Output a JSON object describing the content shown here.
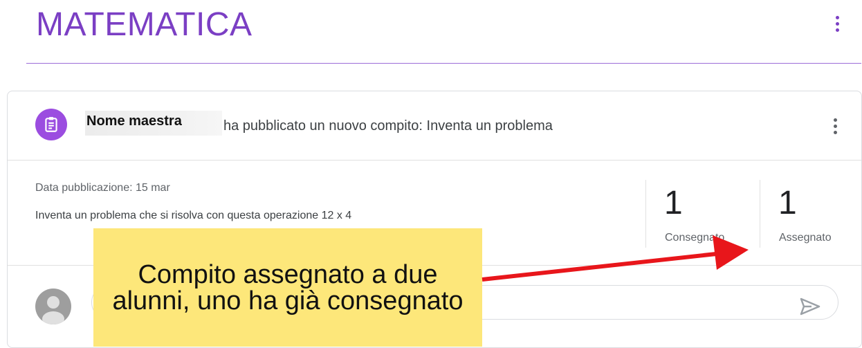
{
  "header": {
    "class_title": "MATEMATICA",
    "menu_icon": "more-vert-icon"
  },
  "post": {
    "author": "Nome maestra",
    "action_text": "ha pubblicato un nuovo compito: Inventa un problema",
    "date": "Data pubblicazione: 15 mar",
    "description": "Inventa un problema che si risolva con questa operazione 12 x 4",
    "menu_icon": "more-vert-icon",
    "assignment_icon": "assignment-icon"
  },
  "stats": {
    "turned_in_count": "1",
    "turned_in_label": "Consegnato",
    "assigned_count": "1",
    "assigned_label": "Assegnato"
  },
  "comment": {
    "send_icon": "send-icon",
    "avatar_icon": "user-avatar-icon"
  },
  "annotation": {
    "text": "Compito assegnato a due alunni, uno ha già consegnato",
    "color": "#fde77a",
    "arrow_color": "#e8161b"
  },
  "colors": {
    "accent": "#7b3fc4",
    "assignment_icon_bg": "#9b4de0"
  }
}
